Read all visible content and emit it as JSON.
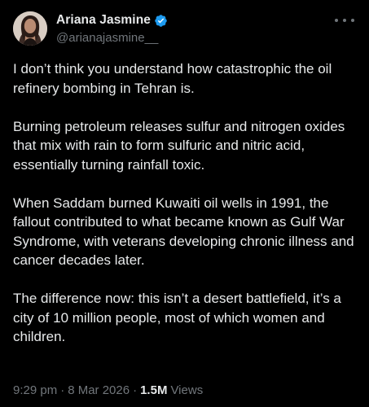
{
  "author": {
    "display_name": "Ariana Jasmine",
    "handle": "@arianajasmine__",
    "verified_color": "#1d9bf0"
  },
  "icons": {
    "verified": "verified-badge-icon",
    "more": "more-options-icon"
  },
  "tweet": {
    "paragraphs": [
      "I don’t think you understand how catastrophic the oil refinery bombing in Tehran is.",
      "Burning petroleum releases sulfur and nitrogen oxides that mix with rain to form sulfuric and nitric acid, essentially turning rainfall toxic.",
      "When Saddam burned Kuwaiti oil wells in 1991, the fallout contributed to what became known as Gulf War Syndrome, with veterans developing chronic illness and cancer decades later.",
      "The difference now: this isn’t a desert battlefield, it’s a city of 10 million people, most of which women and children."
    ]
  },
  "meta": {
    "time": "9:29 pm",
    "separator": "·",
    "date": "8 Mar 2026",
    "views_count": "1.5M",
    "views_label": "Views"
  }
}
